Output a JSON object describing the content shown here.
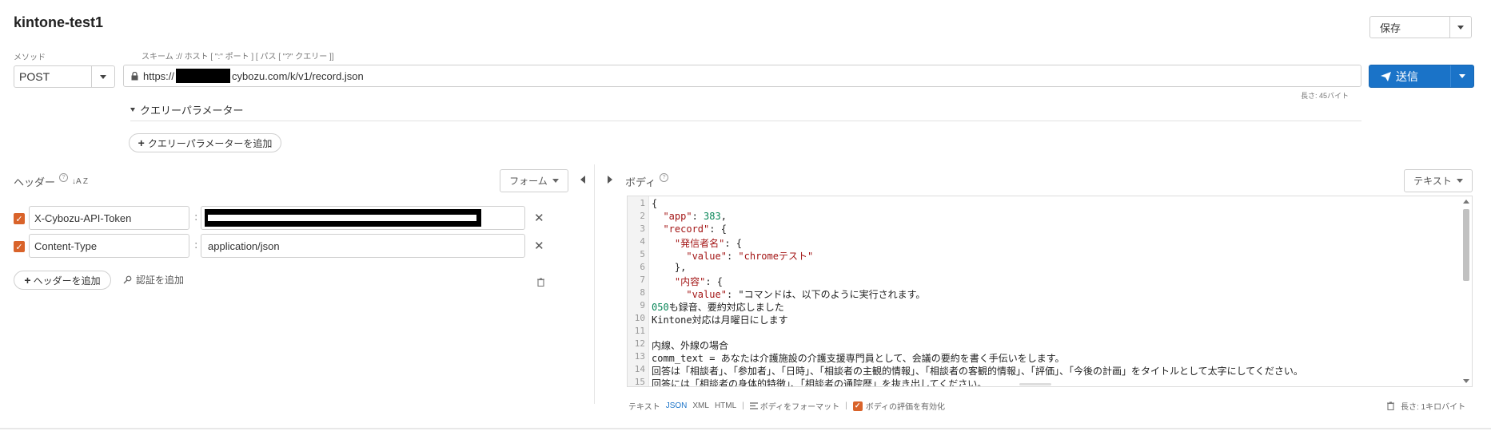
{
  "request": {
    "title": "kintone-test1",
    "save_label": "保存",
    "method_label": "メソッド",
    "method": "POST",
    "url_label": "スキーム :// ホスト [ \":\" ポート ] [ パス [ \"?\" クエリー ]]",
    "url_prefix": "https://",
    "url_suffix": "cybozu.com/k/v1/record.json",
    "url_length": "長さ: 45バイト",
    "send_label": "送信",
    "query_section": "クエリーパラメーター",
    "add_query": "クエリーパラメーターを追加"
  },
  "headers": {
    "label": "ヘッダー",
    "sort": "↓A Z",
    "form_label": "フォーム",
    "rows": [
      {
        "name": "X-Cybozu-API-Token",
        "value": ""
      },
      {
        "name": "Content-Type",
        "value": "application/json"
      }
    ],
    "colon": ":",
    "add_header": "ヘッダーを追加",
    "add_auth": "認証を追加"
  },
  "body": {
    "label": "ボディ",
    "mode": "テキスト",
    "lines": [
      {
        "n": "1",
        "t": "{"
      },
      {
        "n": "2",
        "t": "  \"app\": 383,"
      },
      {
        "n": "3",
        "t": "  \"record\": {"
      },
      {
        "n": "4",
        "t": "    \"発信者名\": {"
      },
      {
        "n": "5",
        "t": "      \"value\": \"chromeテスト\""
      },
      {
        "n": "6",
        "t": "    },"
      },
      {
        "n": "7",
        "t": "    \"内容\": {"
      },
      {
        "n": "8",
        "t": "      \"value\": \"コマンドは、以下のように実行されます。"
      },
      {
        "n": "9",
        "t": "050も録音、要約対応しました"
      },
      {
        "n": "10",
        "t": "Kintone対応は月曜日にします"
      },
      {
        "n": "11",
        "t": ""
      },
      {
        "n": "12",
        "t": "内線、外線の場合"
      },
      {
        "n": "13",
        "t": "comm_text = あなたは介護施設の介護支援専門員として、会議の要約を書く手伝いをします。"
      },
      {
        "n": "14",
        "t": "回答は「相談者」、「参加者」、「日時」、「相談者の主観的情報」、「相談者の客観的情報」、「評価」、「今後の計画」をタイトルとして太字にしてください。"
      },
      {
        "n": "15",
        "t": "回答には「相談者の身体的特徴」、「相談者の通院歴」を抜き出してください。"
      }
    ],
    "footer": {
      "text": "テキスト",
      "json": "JSON",
      "xml": "XML",
      "html": "HTML",
      "bar": "|",
      "format": "ボディをフォーマット",
      "eval": "ボディの評価を有効化",
      "length": "長さ: 1キロバイト"
    }
  },
  "colors": {
    "accent": "#1a73c8",
    "checkbox": "#d9632a",
    "json_key": "#a31515",
    "json_number": "#098658"
  }
}
